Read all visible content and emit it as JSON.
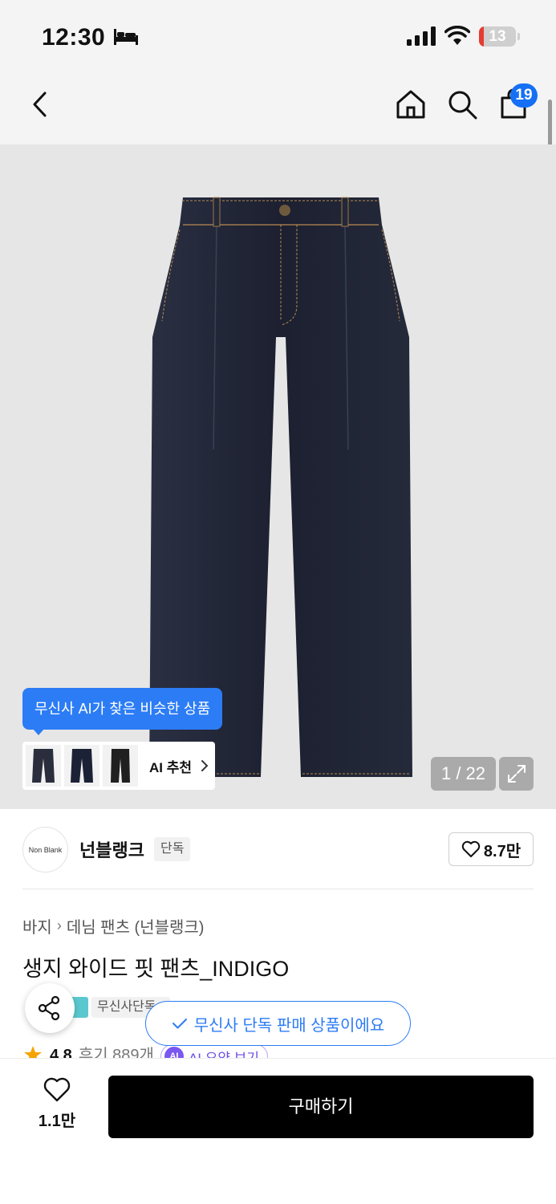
{
  "status_bar": {
    "time": "12:30",
    "battery_level": "13",
    "battery_fraction": 0.13,
    "icons": [
      "bed-icon",
      "signal-icon",
      "wifi-icon",
      "battery-icon"
    ]
  },
  "nav": {
    "icons": [
      "back-chevron-icon",
      "home-icon",
      "search-icon",
      "shopping-bag-icon"
    ],
    "cart_count": "19"
  },
  "gallery": {
    "image": "indigo-wide-pants-image",
    "ai_tooltip": "무신사 AI가 찾은 비슷한 상품",
    "ai_recommend_label": "AI 추천",
    "counter": "1 / 22"
  },
  "brand": {
    "logo_text": "Non Blank",
    "name": "넌블랭크",
    "tag": "단독",
    "likes": "8.7만"
  },
  "product": {
    "breadcrumb": [
      "바지",
      "데님 팬츠 (넌블랭크)"
    ],
    "title": "생지 와이드 핏 팬츠_INDIGO",
    "badge": "무신사단독",
    "exclusive_notice": "무신사 단독 판매 상품이에요",
    "rating": "4.8",
    "reviews": "후기 889개",
    "ai_summary_icon": "AI",
    "ai_summary": "AI 요약 보기"
  },
  "bottom_bar": {
    "likes": "1.1만",
    "buy_label": "구매하기"
  },
  "colors": {
    "accent_blue": "#2c7cf5",
    "badge_blue": "#1670f5",
    "battery_red": "#e63b30",
    "ai_purple": "#7a57f0",
    "star_orange": "#f5a300",
    "denim": "#1d2130"
  }
}
